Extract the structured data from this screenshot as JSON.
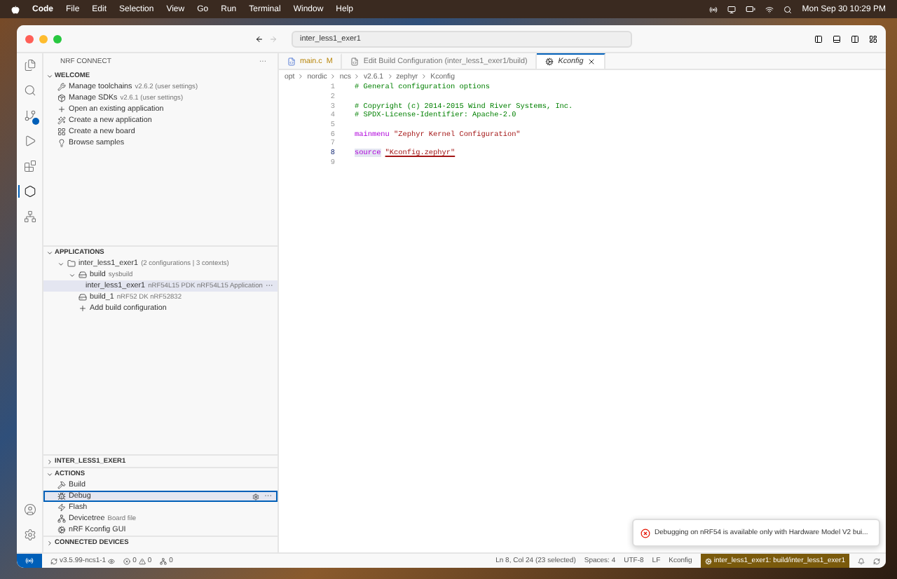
{
  "menubar": {
    "app": "Code",
    "menus": [
      "File",
      "Edit",
      "Selection",
      "View",
      "Go",
      "Run",
      "Terminal",
      "Window",
      "Help"
    ],
    "clock": "Mon Sep 30  10:29 PM"
  },
  "window": {
    "search": "inter_less1_exer1"
  },
  "activity_bar": {
    "items": [
      {
        "kind": "files",
        "selected": false
      },
      {
        "kind": "search",
        "selected": false
      },
      {
        "kind": "source-control",
        "selected": false
      },
      {
        "kind": "run",
        "selected": false
      },
      {
        "kind": "extensions",
        "selected": false
      },
      {
        "kind": "nrf",
        "selected": true
      },
      {
        "kind": "tree",
        "selected": false
      }
    ]
  },
  "sidebar": {
    "title": "NRF CONNECT",
    "menu": "···",
    "welcome": {
      "title": "WELCOME",
      "expanded": true,
      "items": [
        {
          "kind": "toolchain",
          "label": "Manage toolchains",
          "detail": "v2.6.2 (user settings)"
        },
        {
          "kind": "sdk",
          "label": "Manage SDKs",
          "detail": "v2.6.1 (user settings)"
        },
        {
          "kind": "add",
          "label": "Open an existing application"
        },
        {
          "kind": "wand",
          "label": "Create a new application"
        },
        {
          "kind": "board",
          "label": "Create a new board"
        },
        {
          "kind": "samples",
          "label": "Browse samples"
        }
      ]
    },
    "applications": {
      "title": "APPLICATIONS",
      "expanded": true,
      "tree": [
        {
          "kind": "app",
          "label": "inter_less1_exer1",
          "detail": "(2 configurations | 3 contexts)",
          "expanded": true,
          "selected": false,
          "children": [
            {
              "kind": "build",
              "label": "build",
              "detail": "sysbuild",
              "expanded": true,
              "selected": false,
              "children": [
                {
                  "kind": "image",
                  "label": "inter_less1_exer1",
                  "detail": "nRF54L15 PDK nRF54L15 Application",
                  "selected": true,
                  "menu": "···"
                }
              ]
            },
            {
              "kind": "build",
              "label": "build_1",
              "detail": "nRF52 DK nRF52832",
              "selected": false
            },
            {
              "kind": "add",
              "label": "Add build configuration",
              "selected": false
            }
          ]
        }
      ]
    },
    "project": {
      "title": "INTER_LESS1_EXER1",
      "expanded": false
    },
    "actions": {
      "title": "ACTIONS",
      "expanded": true,
      "items": [
        {
          "kind": "build",
          "label": "Build",
          "selected": false
        },
        {
          "kind": "debug",
          "label": "Debug",
          "selected": true,
          "menu": "···"
        },
        {
          "kind": "flash",
          "label": "Flash",
          "selected": false
        },
        {
          "kind": "tree",
          "label": "Devicetree",
          "detail": "Board file",
          "selected": false
        },
        {
          "kind": "gear",
          "label": "nRF Kconfig GUI",
          "selected": false
        }
      ]
    },
    "devices": {
      "title": "CONNECTED DEVICES",
      "expanded": false
    }
  },
  "tabs": [
    {
      "label": "main.c",
      "badge": "M",
      "kind": "c",
      "selected": false
    },
    {
      "label": "Edit Build Configuration (inter_less1_exer1/build)",
      "kind": "edit",
      "selected": false
    },
    {
      "label": "Kconfig",
      "kind": "gear",
      "selected": true
    }
  ],
  "breadcrumb": [
    "opt",
    "nordic",
    "ncs",
    "v2.6.1",
    "zephyr",
    "Kconfig"
  ],
  "code": [
    {
      "number": "1",
      "selected": false,
      "tokens": [
        {
          "kind": "comment",
          "text": "# General configuration options"
        }
      ]
    },
    {
      "number": "2",
      "selected": false
    },
    {
      "number": "3",
      "selected": false,
      "tokens": [
        {
          "kind": "comment",
          "text": "# Copyright (c) 2014-2015 Wind River Systems, Inc."
        }
      ]
    },
    {
      "number": "4",
      "selected": false,
      "tokens": [
        {
          "kind": "comment",
          "text": "# SPDX-License-Identifier: Apache-2.0"
        }
      ]
    },
    {
      "number": "5",
      "selected": false
    },
    {
      "number": "6",
      "selected": false,
      "tokens": [
        {
          "kind": "keyword",
          "text": "mainmenu"
        },
        {
          "kind": "string",
          "text": "\"Zephyr Kernel Configuration\""
        }
      ]
    },
    {
      "number": "7",
      "selected": false
    },
    {
      "number": "8",
      "selected": true,
      "tokens": [
        {
          "kind": "keyword",
          "text": "source"
        },
        {
          "kind": "link",
          "text": "\"Kconfig.zephyr\""
        }
      ]
    },
    {
      "number": "9",
      "selected": false
    }
  ],
  "notification": {
    "kind": "error",
    "text": "Debugging on nRF54 is available only with Hardware Model V2 bui..."
  },
  "status_bar": {
    "version": "v3.5.99-ncs1-1",
    "errors": "0",
    "warnings": "0",
    "ports": "0",
    "position": "Ln 8, Col 24 (23 selected)",
    "spaces": "Spaces: 4",
    "encoding": "UTF-8",
    "eol": "LF",
    "language": "Kconfig",
    "context": "inter_less1_exer1: build/inter_less1_exer1"
  }
}
